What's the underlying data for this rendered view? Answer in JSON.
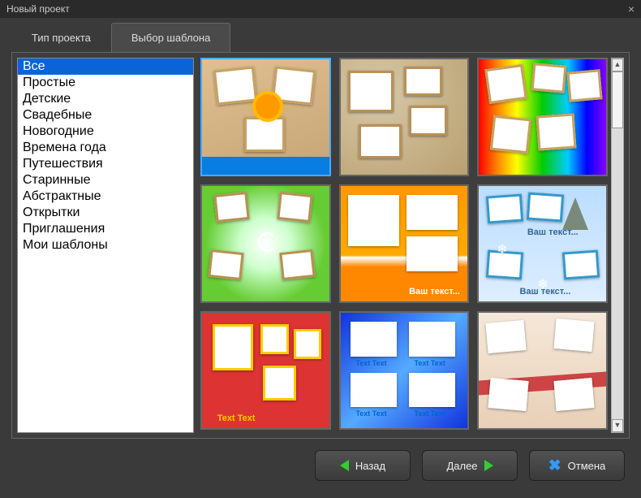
{
  "window": {
    "title": "Новый проект"
  },
  "tabs": {
    "project_type": "Тип проекта",
    "template_select": "Выбор шаблона",
    "active": "template_select"
  },
  "categories": [
    "Все",
    "Простые",
    "Детские",
    "Свадебные",
    "Новогодние",
    "Времена года",
    "Путешествия",
    "Старинные",
    "Абстрактные",
    "Открытки",
    "Приглашения",
    "Мои шаблоны"
  ],
  "selected_category_index": 0,
  "selected_template_index": 0,
  "templates": [
    {
      "bg": "bg1"
    },
    {
      "bg": "bg2"
    },
    {
      "bg": "bg3"
    },
    {
      "bg": "bg4"
    },
    {
      "bg": "bg5",
      "label": "Ваш текст..."
    },
    {
      "bg": "bg6",
      "label_top": "Ваш текст...",
      "label_bottom": "Ваш текст..."
    },
    {
      "bg": "bg7",
      "label": "Text Text"
    },
    {
      "bg": "bg8",
      "labels": [
        "Text Text",
        "Text Text",
        "Text Text",
        "Text Text"
      ]
    },
    {
      "bg": "bg9"
    }
  ],
  "buttons": {
    "back": "Назад",
    "next": "Далее",
    "cancel": "Отмена"
  }
}
